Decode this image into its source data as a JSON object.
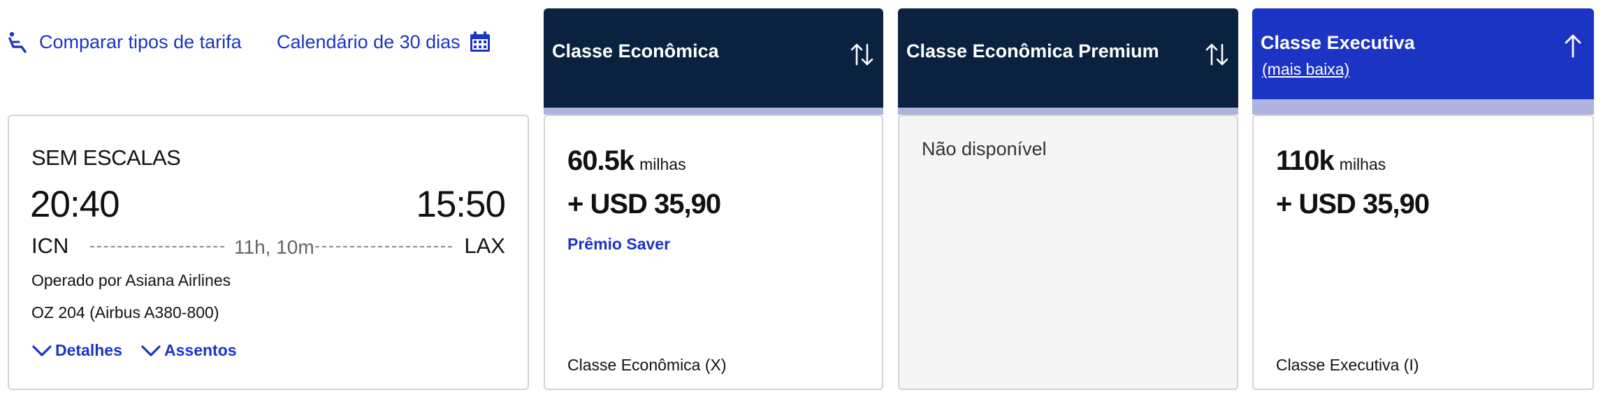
{
  "toolbar": {
    "compare_label": "Comparar tipos de tarifa",
    "compare_icon": "seat-recline-icon",
    "calendar_label": "Calendário de 30 dias",
    "calendar_icon": "calendar-icon"
  },
  "flight": {
    "stops": "SEM ESCALAS",
    "departure_time": "20:40",
    "arrival_time": "15:50",
    "origin": "ICN",
    "destination": "LAX",
    "duration": "11h, 10m",
    "operator": "Operado por Asiana Airlines",
    "flight_number": "OZ 204 (Airbus A380-800)",
    "details_label": "Detalhes",
    "seats_label": "Assentos"
  },
  "columns": {
    "economy": {
      "title": "Classe Econômica",
      "sort_icon": "sort-arrows-icon"
    },
    "premium": {
      "title": "Classe Econômica Premium",
      "sort_icon": "sort-arrows-icon"
    },
    "executive": {
      "title": "Classe Executiva",
      "subtitle": "(mais baixa)",
      "sort_icon": "arrow-up-icon"
    }
  },
  "fares": {
    "economy": {
      "miles": "60.5k",
      "miles_unit": "milhas",
      "price": "+ USD 35,90",
      "award": "Prêmio Saver",
      "fare_class": "Classe Econômica (X)"
    },
    "premium": {
      "unavailable": "Não disponível"
    },
    "executive": {
      "miles": "110k",
      "miles_unit": "milhas",
      "price": "+ USD 35,90",
      "fare_class": "Classe Executiva (I)"
    }
  },
  "colors": {
    "link_blue": "#1b34c4",
    "header_navy": "#0a2240",
    "header_highlight": "#1b34c4",
    "header_bar": "#aeb4dd",
    "border": "#d4d4d4",
    "unavailable_bg": "#f5f5f5"
  }
}
